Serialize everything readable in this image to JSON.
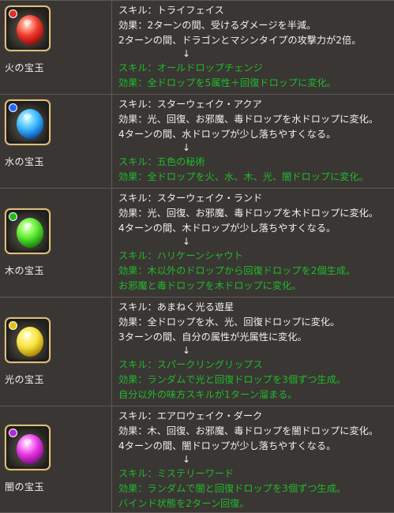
{
  "rows": [
    {
      "name": "火の宝玉",
      "icon": "fire-gem-icon",
      "orb_color": "#f23a2e",
      "badge_color": "#e43124",
      "skill_1": "スキル：トライフェイス",
      "desc_1": [
        "効果：2ターンの間、受けるダメージを半減。",
        "2ターンの間、ドラゴンとマシンタイプの攻撃力が2倍。"
      ],
      "arrow": "↓",
      "skill_2": "スキル：オールドロップチェンジ",
      "desc_2": [
        "効果：全ドロップを5属性＋回復ドロップに変化。"
      ]
    },
    {
      "name": "水の宝玉",
      "icon": "water-gem-icon",
      "orb_color": "#3db6ff",
      "badge_color": "#1f67ff",
      "skill_1": "スキル：スターウェイク・アクア",
      "desc_1": [
        "効果：光、回復、お邪魔、毒ドロップを水ドロップに変化。",
        "4ターンの間、水ドロップが少し落ちやすくなる。"
      ],
      "arrow": "↓",
      "skill_2": "スキル：五色の秘術",
      "desc_2": [
        "効果：全ドロップを火、水、木、光、闇ドロップに変化。"
      ]
    },
    {
      "name": "木の宝玉",
      "icon": "wood-gem-icon",
      "orb_color": "#59e82f",
      "badge_color": "#23b81c",
      "skill_1": "スキル：スターウェイク・ランド",
      "desc_1": [
        "効果：光、回復、お邪魔、毒ドロップを木ドロップに変化。",
        "4ターンの間、木ドロップが少し落ちやすくなる。"
      ],
      "arrow": "↓",
      "skill_2": "スキル：ハリケーンシャウト",
      "desc_2": [
        "効果：木以外のドロップから回復ドロップを2個生成。",
        "お邪魔と毒ドロップを木ドロップに変化。"
      ]
    },
    {
      "name": "光の宝玉",
      "icon": "light-gem-icon",
      "orb_color": "#f7e33d",
      "badge_color": "#e3c40e",
      "skill_1": "スキル：あまねく光る遊星",
      "desc_1": [
        "効果：全ドロップを水、光、回復ドロップに変化。",
        "3ターンの間、自分の属性が光属性に変化。"
      ],
      "arrow": "↓",
      "skill_2": "スキル：スパークリングリップス",
      "desc_2": [
        "効果：ランダムで光と回復ドロップを3個ずつ生成。",
        "自分以外の味方スキルが1ターン溜まる。"
      ]
    },
    {
      "name": "闇の宝玉",
      "icon": "dark-gem-icon",
      "orb_color": "#e838e2",
      "badge_color": "#b22bd4",
      "skill_1": "スキル：エアロウェイク・ダーク",
      "desc_1": [
        "効果：木、回復、お邪魔、毒ドロップを闇ドロップに変化。",
        "4ターンの間、闇ドロップが少し落ちやすくなる。"
      ],
      "arrow": "↓",
      "skill_2": "スキル：ミステリーワード",
      "desc_2": [
        "効果：ランダムで闇と回復ドロップを3個ずつ生成。",
        "バインド状態を2ターン回復。"
      ]
    }
  ]
}
